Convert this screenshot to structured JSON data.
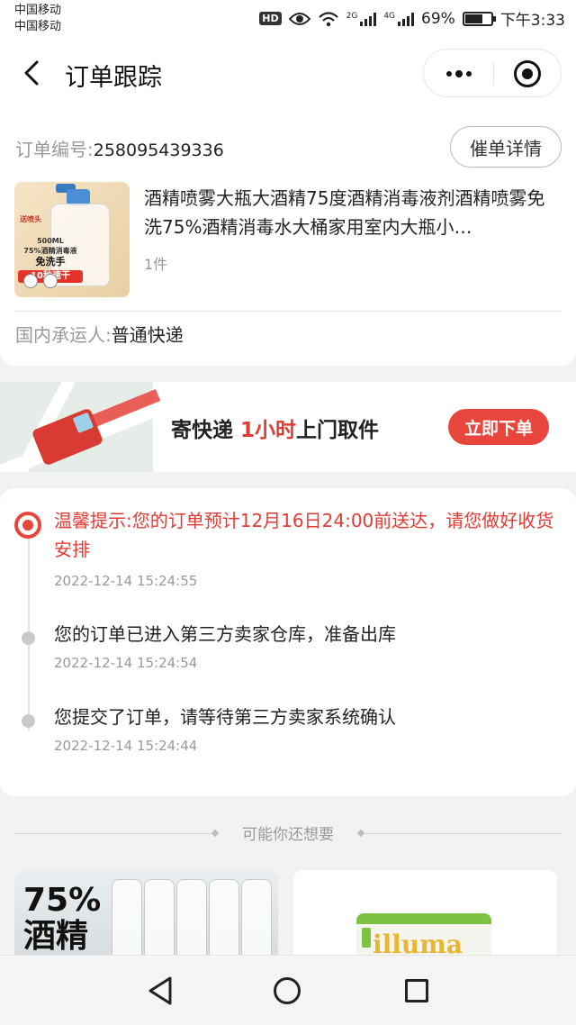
{
  "status_bar": {
    "carrier_1": "中国移动",
    "carrier_2": "中国移动",
    "hd": "HD",
    "net_1": "2G",
    "net_2": "4G",
    "battery": "69%",
    "battery_level": 0.69,
    "time": "下午3:33"
  },
  "header": {
    "back_icon": "chevron-left-icon",
    "title": "订单跟踪",
    "more_icon": "more-dots-icon",
    "close_icon": "target-circle-icon"
  },
  "order": {
    "number_label": "订单编号:",
    "number": "258095439336",
    "urge_button": "催单详情",
    "product": {
      "title": "酒精喷雾大瓶大酒精75度酒精消毒液剂酒精喷雾免洗75%酒精消毒水大桶家用室内大瓶小…",
      "quantity": "1件",
      "thumb_tag": "送喷头",
      "thumb_line1": "500ML",
      "thumb_line2": "75%酒精消毒液",
      "thumb_line3": "免洗手",
      "thumb_line4": "10秒速干"
    },
    "carrier_label": "国内承运人:",
    "carrier_value": "普通快递"
  },
  "banner": {
    "text_before": "寄快递 ",
    "text_highlight": "1小时",
    "text_after": "上门取件",
    "button": "立即下单"
  },
  "tracking": {
    "events": [
      {
        "text": "温馨提示:您的订单预计12月16日24:00前送达，请您做好收货安排",
        "time": "2022-12-14  15:24:55",
        "active": true
      },
      {
        "text": "您的订单已进入第三方卖家仓库，准备出库",
        "time": "2022-12-14  15:24:54",
        "active": false
      },
      {
        "text": "您提交了订单，请等待第三方卖家系统确认",
        "time": "2022-12-14  15:24:44",
        "active": false
      }
    ]
  },
  "recommend": {
    "title": "可能你还想要",
    "item1_text_1": "75%",
    "item1_text_2": "酒精",
    "item2_brand": "illuma"
  },
  "nav": {
    "back_icon": "triangle-back-icon",
    "home_icon": "circle-home-icon",
    "recent_icon": "square-recent-icon"
  },
  "colors": {
    "accent_red": "#e8453c",
    "text_gray": "#999999"
  }
}
